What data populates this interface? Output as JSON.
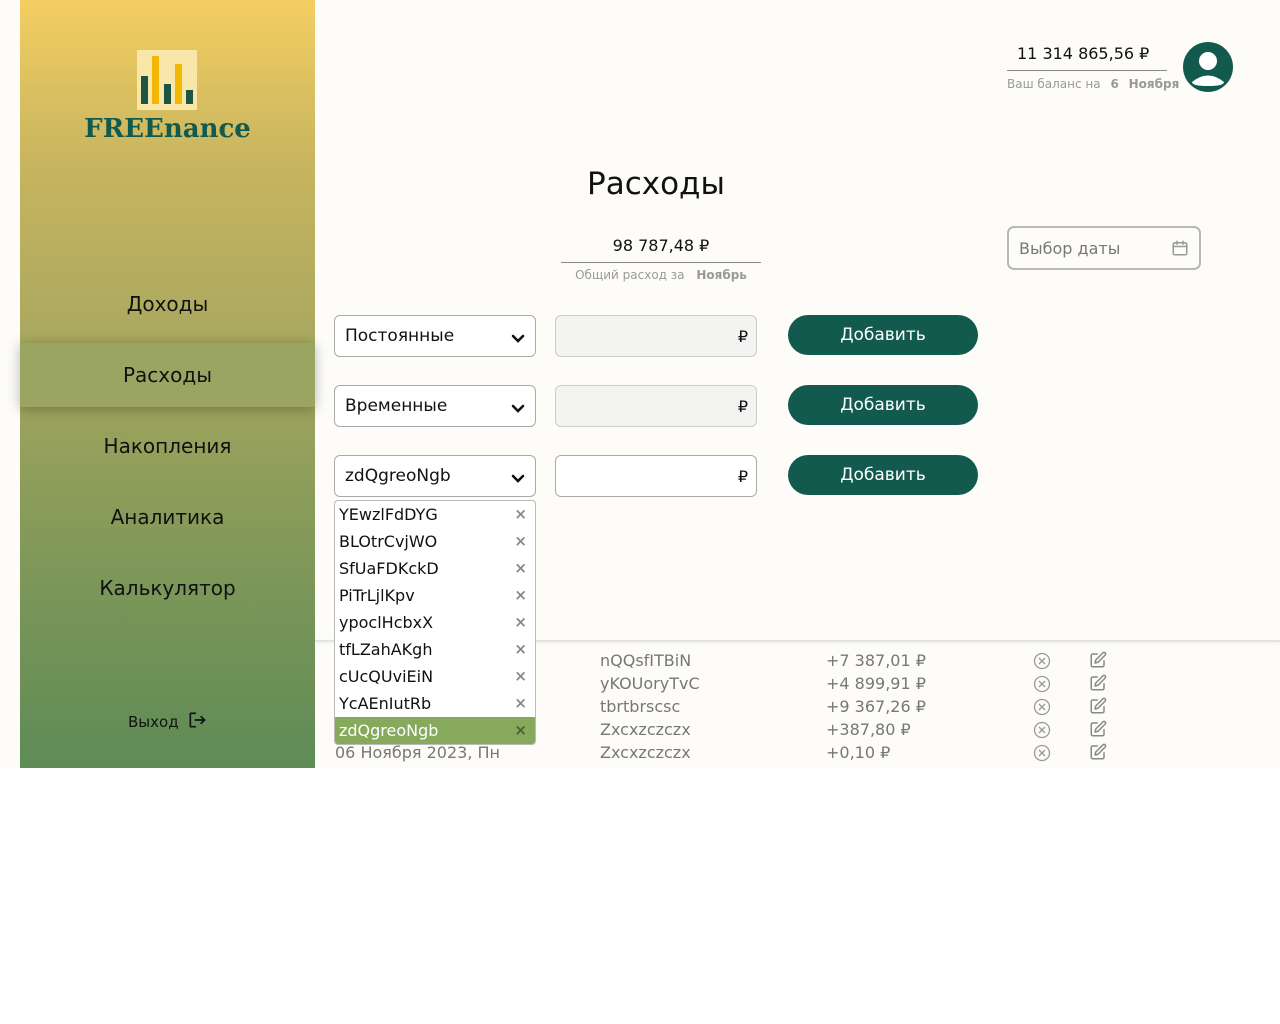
{
  "brand": {
    "name": "FREEnance",
    "logo_colors": [
      "#1d5545",
      "#f2b705",
      "#1d5545",
      "#f2b705",
      "#1d5545"
    ]
  },
  "nav": [
    {
      "label": "Доходы"
    },
    {
      "label": "Расходы",
      "active": true
    },
    {
      "label": "Накопления"
    },
    {
      "label": "Аналитика"
    },
    {
      "label": "Калькулятор"
    }
  ],
  "logout": {
    "label": "Выход"
  },
  "header": {
    "balance": "11 314 865,56 ₽",
    "balance_caption": "Ваш баланс на",
    "balance_day": "6",
    "balance_month": "Ноября"
  },
  "page": {
    "title": "Расходы"
  },
  "total": {
    "amount": "98 787,48 ₽",
    "caption": "Общий расход за",
    "month": "Ноябрь"
  },
  "date_picker": {
    "placeholder": "Выбор даты"
  },
  "forms": [
    {
      "category": "Постоянные",
      "currency": "₽",
      "button": "Добавить"
    },
    {
      "category": "Временные",
      "currency": "₽",
      "button": "Добавить"
    },
    {
      "category": "zdQgreoNgb",
      "currency": "₽",
      "button": "Добавить"
    }
  ],
  "dropdown": {
    "options": [
      "YEwzlFdDYG",
      "BLOtrCvjWO",
      "SfUaFDKckD",
      "PiTrLjlKpv",
      "ypoclHcbxX",
      "tfLZahAKgh",
      "cUcQUviEiN",
      "YcAEnIutRb",
      "zdQgreoNgb"
    ],
    "selected": "zdQgreoNgb",
    "remove_glyph": "×"
  },
  "transactions": [
    {
      "date": "",
      "name": "nQQsfITBiN",
      "amount": "+7 387,01 ₽"
    },
    {
      "date": "",
      "name": "yKOUoryTvC",
      "amount": "+4 899,91 ₽"
    },
    {
      "date": "",
      "name": "tbrtbrscsc",
      "amount": "+9 367,26 ₽"
    },
    {
      "date": "",
      "name": "Zxcxzczczx",
      "amount": "+387,80 ₽"
    },
    {
      "date": "06 Ноября 2023, Пн",
      "name": "Zxcxzczczx",
      "amount": "+0,10 ₽"
    }
  ],
  "colors": {
    "primary": "#135a4e",
    "accent": "#86a95b",
    "gold": "#f4ce62"
  },
  "icons": {
    "logout": "logout-icon",
    "user": "user-icon",
    "calendar": "calendar-icon",
    "chevron": "chevron-down-icon",
    "delete": "delete-icon",
    "edit": "edit-icon"
  }
}
